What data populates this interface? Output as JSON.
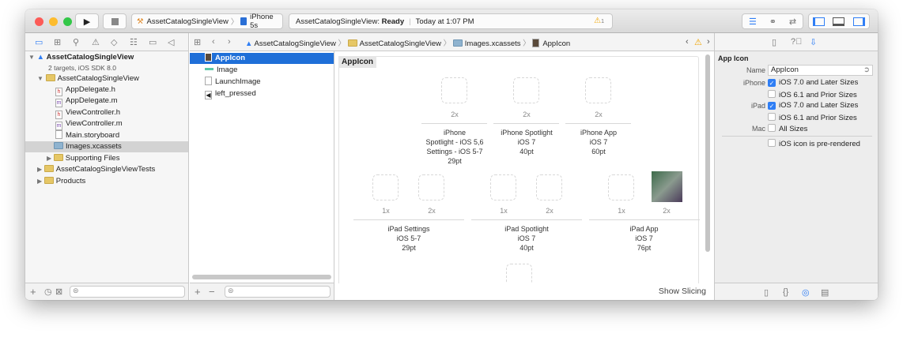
{
  "toolbar": {
    "scheme": "AssetCatalogSingleView",
    "device": "iPhone 5s",
    "status_project": "AssetCatalogSingleView:",
    "status_state": "Ready",
    "status_time": "Today at 1:07 PM",
    "warning_count": "1"
  },
  "breadcrumb": [
    "AssetCatalogSingleView",
    "AssetCatalogSingleView",
    "Images.xcassets",
    "AppIcon"
  ],
  "navigator": {
    "project": "AssetCatalogSingleView",
    "project_sub": "2 targets, iOS SDK 8.0",
    "items": [
      {
        "label": "AssetCatalogSingleView",
        "type": "folder"
      },
      {
        "label": "AppDelegate.h",
        "type": "h"
      },
      {
        "label": "AppDelegate.m",
        "type": "m"
      },
      {
        "label": "ViewController.h",
        "type": "h"
      },
      {
        "label": "ViewController.m",
        "type": "m"
      },
      {
        "label": "Main.storyboard",
        "type": "sb"
      },
      {
        "label": "Images.xcassets",
        "type": "xc"
      },
      {
        "label": "Supporting Files",
        "type": "folder"
      },
      {
        "label": "AssetCatalogSingleViewTests",
        "type": "folder"
      },
      {
        "label": "Products",
        "type": "folder"
      }
    ]
  },
  "assets": [
    "AppIcon",
    "Image",
    "LaunchImage",
    "left_pressed"
  ],
  "canvas": {
    "title": "AppIcon",
    "show_slicing": "Show Slicing",
    "groups1": [
      {
        "scale": "2x",
        "lines": [
          "iPhone",
          "Spotlight - iOS 5,6",
          "Settings - iOS 5-7",
          "29pt"
        ]
      },
      {
        "scale": "2x",
        "lines": [
          "iPhone Spotlight",
          "iOS 7",
          "40pt"
        ]
      },
      {
        "scale": "2x",
        "lines": [
          "iPhone App",
          "iOS 7",
          "60pt"
        ]
      }
    ],
    "groups2": [
      {
        "scales": [
          "1x",
          "2x"
        ],
        "lines": [
          "iPad Settings",
          "iOS 5-7",
          "29pt"
        ]
      },
      {
        "scales": [
          "1x",
          "2x"
        ],
        "lines": [
          "iPad Spotlight",
          "iOS 7",
          "40pt"
        ]
      },
      {
        "scales": [
          "1x",
          "2x"
        ],
        "lines": [
          "iPad App",
          "iOS 7",
          "76pt"
        ]
      }
    ]
  },
  "inspector": {
    "section": "App Icon",
    "name_label": "Name",
    "name_value": "AppIcon",
    "iphone_label": "iPhone",
    "ipad_label": "iPad",
    "mac_label": "Mac",
    "ios7": "iOS 7.0 and Later Sizes",
    "ios6": "iOS 6.1 and Prior Sizes",
    "all_sizes": "All Sizes",
    "prerendered": "iOS icon is pre-rendered"
  }
}
